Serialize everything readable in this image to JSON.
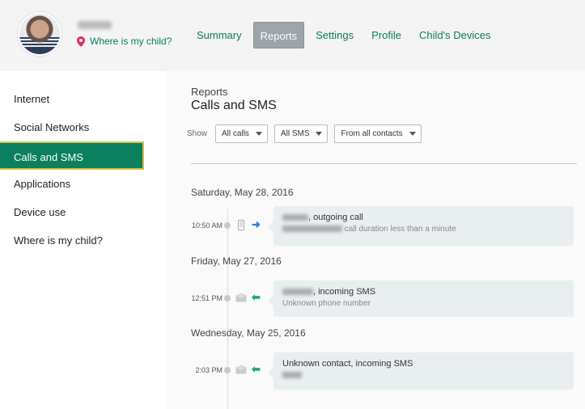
{
  "header": {
    "where_link": "Where is my child?",
    "nav": [
      "Summary",
      "Reports",
      "Settings",
      "Profile",
      "Child's Devices"
    ],
    "active_nav": "Reports"
  },
  "sidebar": {
    "items": [
      {
        "label": "Internet"
      },
      {
        "label": "Social Networks"
      },
      {
        "label": "Calls and SMS"
      },
      {
        "label": "Applications"
      },
      {
        "label": "Device use"
      },
      {
        "label": "Where is my child?"
      }
    ],
    "active": "Calls and SMS"
  },
  "main": {
    "breadcrumb": "Reports",
    "title": "Calls and SMS",
    "filters": {
      "show_label": "Show",
      "calls": "All calls",
      "sms": "All SMS",
      "contacts": "From all contacts"
    },
    "groups": [
      {
        "date": "Saturday, May 28, 2016",
        "entries": [
          {
            "time": "10:50 AM",
            "type": "call",
            "direction": "outgoing",
            "line1": ", outgoing call",
            "line2": " call duration less than a minute"
          }
        ]
      },
      {
        "date": "Friday, May 27, 2016",
        "entries": [
          {
            "time": "12:51 PM",
            "type": "sms",
            "direction": "incoming",
            "line1": ", incoming SMS",
            "line2": "Unknown phone number"
          }
        ]
      },
      {
        "date": "Wednesday, May 25, 2016",
        "entries": [
          {
            "time": "2:03 PM",
            "type": "sms",
            "direction": "incoming",
            "line1": "Unknown contact, incoming SMS",
            "line2": ""
          }
        ]
      }
    ]
  },
  "colors": {
    "accent": "#0b7f5e",
    "link": "#0b7a5a",
    "outgoing_arrow": "#2b7de0",
    "incoming_arrow": "#17a67a",
    "pin": "#e0305a"
  }
}
